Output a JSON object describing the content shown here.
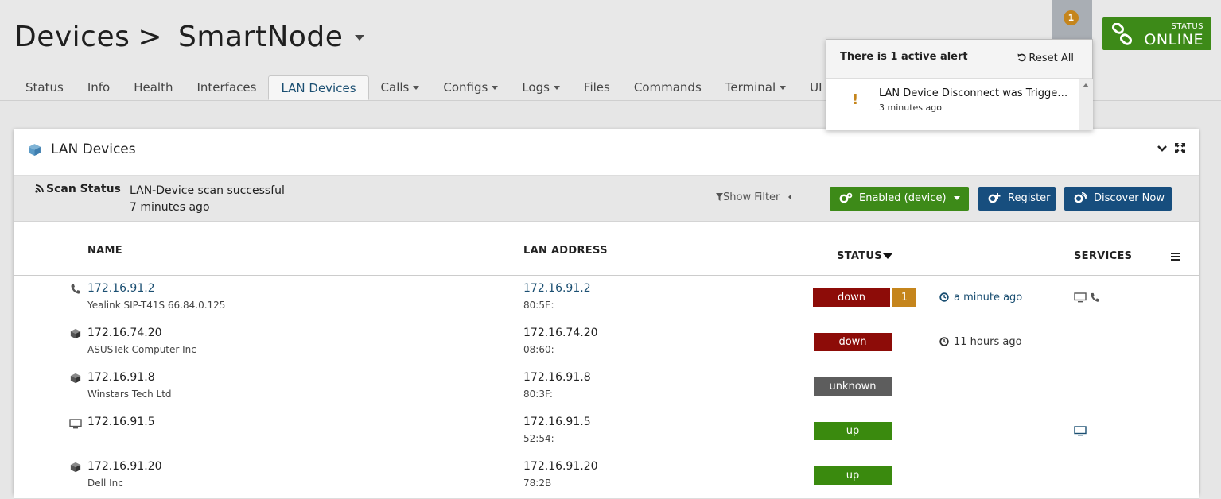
{
  "header": {
    "title": "Devices",
    "separator": ">",
    "node": "SmartNode"
  },
  "tabs": [
    {
      "label": "Status",
      "dropdown": false
    },
    {
      "label": "Info",
      "dropdown": false
    },
    {
      "label": "Health",
      "dropdown": false
    },
    {
      "label": "Interfaces",
      "dropdown": false
    },
    {
      "label": "LAN Devices",
      "dropdown": false,
      "active": true
    },
    {
      "label": "Calls",
      "dropdown": true
    },
    {
      "label": "Configs",
      "dropdown": true
    },
    {
      "label": "Logs",
      "dropdown": true
    },
    {
      "label": "Files",
      "dropdown": false
    },
    {
      "label": "Commands",
      "dropdown": false
    },
    {
      "label": "Terminal",
      "dropdown": true
    },
    {
      "label": "UI",
      "dropdown": true
    }
  ],
  "alerts": {
    "count": "1",
    "title": "There is 1 active alert",
    "reset_label": "Reset All",
    "items": [
      {
        "text": "LAN Device Disconnect was Triggered",
        "time": "3 minutes ago"
      }
    ]
  },
  "status": {
    "label": "STATUS",
    "value": "ONLINE"
  },
  "panel": {
    "title": "LAN Devices",
    "scan_label": "Scan Status",
    "scan_text": "LAN-Device scan successful",
    "scan_time": "7 minutes ago",
    "show_filter": "Show Filter",
    "enabled_button": "Enabled (device)",
    "register_button": "Register",
    "discover_button": "Discover Now"
  },
  "table": {
    "headers": {
      "name": "NAME",
      "address": "LAN ADDRESS",
      "status": "STATUS",
      "services": "SERVICES"
    },
    "rows": [
      {
        "icon": "phone-icon",
        "name": "172.16.91.2",
        "sub": "Yealink SIP-T41S 66.84.0.125",
        "address": "172.16.91.2",
        "mac": "80:5E:",
        "status": "down",
        "alert_count": "1",
        "time": "a minute ago",
        "services": [
          "monitor-icon",
          "phone-icon"
        ]
      },
      {
        "icon": "cube-icon",
        "name": "172.16.74.20",
        "sub": "ASUSTek Computer Inc",
        "address": "172.16.74.20",
        "mac": "08:60:",
        "status": "down",
        "alert_count": "",
        "time": "11 hours ago",
        "services": []
      },
      {
        "icon": "cube-icon",
        "name": "172.16.91.8",
        "sub": "Winstars Tech Ltd",
        "address": "172.16.91.8",
        "mac": "80:3F:",
        "status": "unknown",
        "alert_count": "",
        "time": "",
        "services": []
      },
      {
        "icon": "monitor-icon",
        "name": "172.16.91.5",
        "sub": "",
        "address": "172.16.91.5",
        "mac": "52:54:",
        "status": "up",
        "alert_count": "",
        "time": "",
        "services": [
          "monitor-icon"
        ]
      },
      {
        "icon": "cube-icon",
        "name": "172.16.91.20",
        "sub": "Dell Inc",
        "address": "172.16.91.20",
        "mac": "78:2B",
        "status": "up",
        "alert_count": "",
        "time": "",
        "services": []
      }
    ]
  },
  "colors": {
    "down": "#8d0c08",
    "unknown": "#5d5d5d",
    "up": "#3a8a0e",
    "alert": "#c5851c",
    "primary": "#174e7e",
    "online": "#3d8a18"
  }
}
